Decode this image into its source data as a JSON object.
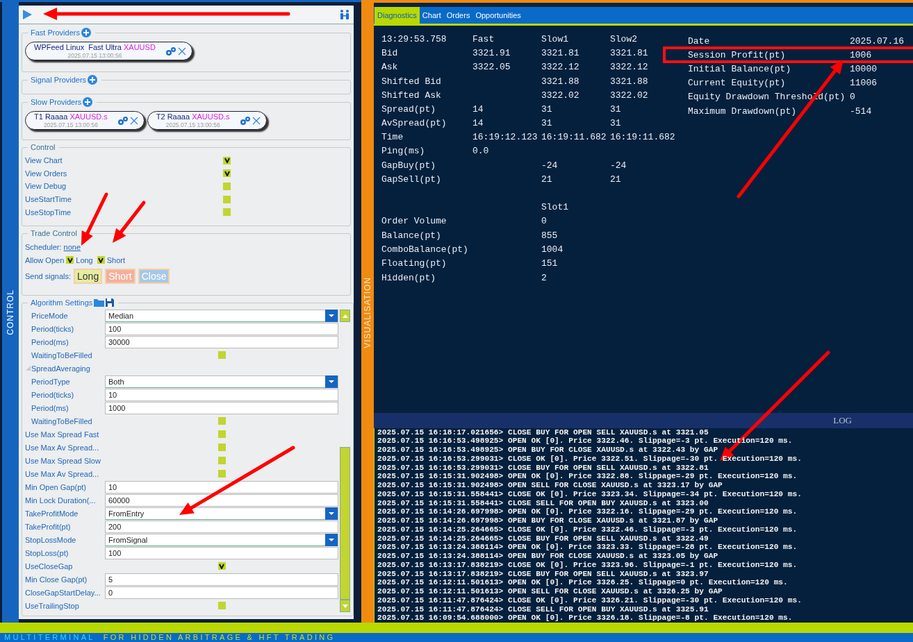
{
  "control_panel": {
    "side_label": "CONTROL",
    "fast_providers": {
      "title": "Fast Providers",
      "providers": [
        {
          "name": "WPFeed Linux  Fast Ultra",
          "symbol": "XAUUSD",
          "timestamp": "2025.07.15 13:00:56"
        }
      ]
    },
    "signal_providers": {
      "title": "Signal Providers"
    },
    "slow_providers": {
      "title": "Slow Providers",
      "providers": [
        {
          "name": "T1 Raaaa",
          "symbol": "XAUUSD.s",
          "timestamp": "2025.07.15 13:00:56"
        },
        {
          "name": "T2 Raaaa",
          "symbol": "XAUUSD.s",
          "timestamp": "2025.07.15 13:00:56"
        }
      ]
    },
    "control": {
      "title": "Control",
      "items": [
        {
          "label": "View Chart",
          "checked": true
        },
        {
          "label": "View Orders",
          "checked": true
        },
        {
          "label": "View Debug",
          "checked": false
        },
        {
          "label": "UseStartTime",
          "checked": false
        },
        {
          "label": "UseStopTime",
          "checked": false
        }
      ]
    },
    "trade_control": {
      "title": "Trade Control",
      "scheduler_label": "Scheduler:",
      "scheduler_value": "none",
      "allow_open_label": "Allow Open",
      "allow_open": [
        {
          "label": "Long",
          "checked": true
        },
        {
          "label": "Short",
          "checked": true
        }
      ],
      "send_signals_label": "Send signals:",
      "signal_buttons": [
        {
          "label": "Long",
          "kind": "long"
        },
        {
          "label": "Short",
          "kind": "short"
        },
        {
          "label": "Close",
          "kind": "close"
        }
      ]
    },
    "algorithm_settings": {
      "title": "Algorithm Settings",
      "rows": [
        {
          "kind": "group",
          "children": [
            {
              "kind": "dropdown",
              "label": "PriceMode",
              "value": "Median"
            },
            {
              "kind": "input",
              "label": "Period(ticks)",
              "value": "100"
            },
            {
              "kind": "input",
              "label": "Period(ms)",
              "value": "30000"
            },
            {
              "kind": "checkbox",
              "label": "WaitingToBeFilled",
              "checked": false
            }
          ]
        },
        {
          "kind": "group",
          "label": "SpreadAveraging",
          "expanded": true,
          "children": [
            {
              "kind": "dropdown",
              "label": "PeriodType",
              "value": "Both"
            },
            {
              "kind": "input",
              "label": "Period(ticks)",
              "value": "10"
            },
            {
              "kind": "input",
              "label": "Period(ms)",
              "value": "1000"
            },
            {
              "kind": "checkbox",
              "label": "WaitingToBeFilled",
              "checked": false
            }
          ]
        },
        {
          "kind": "checkbox",
          "label": "Use Max Spread Fast",
          "checked": false
        },
        {
          "kind": "checkbox",
          "label": "Use Max Av Spread...",
          "checked": false
        },
        {
          "kind": "checkbox",
          "label": "Use Max Spread Slow",
          "checked": false
        },
        {
          "kind": "checkbox",
          "label": "Use Max Av Spread...",
          "checked": false
        },
        {
          "kind": "input",
          "label": "Min Open Gap(pt)",
          "value": "10"
        },
        {
          "kind": "input",
          "label": "Min Lock Duration(...",
          "value": "60000"
        },
        {
          "kind": "dropdown",
          "label": "TakeProfitMode",
          "value": "FromEntry"
        },
        {
          "kind": "input",
          "label": "TakeProfit(pt)",
          "value": "200"
        },
        {
          "kind": "dropdown",
          "label": "StopLossMode",
          "value": "FromSignal"
        },
        {
          "kind": "input",
          "label": "StopLoss(pt)",
          "value": "100"
        },
        {
          "kind": "checkbox",
          "label": "UseCloseGap",
          "checked": true
        },
        {
          "kind": "input",
          "label": "Min Close Gap(pt)",
          "value": "5"
        },
        {
          "kind": "input",
          "label": "CloseGapStartDelay...",
          "value": "0"
        },
        {
          "kind": "checkbox",
          "label": "UseTrailingStop",
          "checked": false
        }
      ]
    }
  },
  "visualisation": {
    "side_label": "VISUALISATION",
    "tabs": [
      {
        "label": "Diagnostics",
        "selected": true
      },
      {
        "label": "Chart",
        "selected": false
      },
      {
        "label": "Orders",
        "selected": false
      },
      {
        "label": "Opportunities",
        "selected": false
      }
    ],
    "quotes": {
      "header": [
        "13:29:53.758",
        "Fast",
        "Slow1",
        "Slow2"
      ],
      "rows": [
        [
          "Bid",
          "3321.91",
          "3321.81",
          "3321.81"
        ],
        [
          "Ask",
          "3322.05",
          "3322.12",
          "3322.12"
        ],
        [
          "Shifted Bid",
          "",
          "3321.88",
          "3321.88"
        ],
        [
          "Shifted Ask",
          "",
          "3322.02",
          "3322.02"
        ],
        [
          "Spread(pt)",
          "14",
          "31",
          "31"
        ],
        [
          "AvSpread(pt)",
          "14",
          "31",
          "31"
        ],
        [
          "Time",
          "16:19:12.123",
          "16:19:11.682",
          "16:19:11.682"
        ],
        [
          "Ping(ms)",
          "0.0",
          "",
          ""
        ],
        [
          "GapBuy(pt)",
          "",
          "-24",
          "-24"
        ],
        [
          "GapSell(pt)",
          "",
          "21",
          "21"
        ]
      ]
    },
    "account": [
      {
        "label": "Date",
        "value": "2025.07.16",
        "highlighted": false
      },
      {
        "label": "Session Profit(pt)",
        "value": "1006",
        "highlighted": true
      },
      {
        "label": "Initial Balance(pt)",
        "value": "10000",
        "highlighted": false
      },
      {
        "label": "Current Equity(pt)",
        "value": "11006",
        "highlighted": false
      },
      {
        "label": "Equity Drawdown Threshold(pt)",
        "value": "0",
        "highlighted": false
      },
      {
        "label": "Maximum Drawdown(pt)",
        "value": "-514",
        "highlighted": false
      }
    ],
    "slots": {
      "header": "Slot1",
      "rows": [
        [
          "Order Volume",
          "0"
        ],
        [
          "Balance(pt)",
          "855"
        ],
        [
          "ComboBalance(pt)",
          "1004"
        ],
        [
          "Floating(pt)",
          "151"
        ],
        [
          "Hidden(pt)",
          "2"
        ]
      ]
    },
    "log": {
      "title": "LOG",
      "lines": [
        "2025.07.15 16:18:17.021656> CLOSE BUY FOR OPEN SELL XAUUSD.s at 3321.05",
        "2025.07.15 16:16:53.498925> OPEN OK [0]. Price 3322.46. Slippage=-3 pt. Execution=120 ms.",
        "2025.07.15 16:16:53.498925> OPEN BUY FOR CLOSE XAUUSD.s at 3322.43 by GAP",
        "2025.07.15 16:16:53.299031> CLOSE OK [0]. Price 3322.51. Slippage=-30 pt. Execution=120 ms.",
        "2025.07.15 16:16:53.299031> CLOSE BUY FOR OPEN SELL XAUUSD.s at 3322.81",
        "2025.07.15 16:15:31.902498> OPEN OK [0]. Price 3322.88. Slippage=-29 pt. Execution=120 ms.",
        "2025.07.15 16:15:31.902498> OPEN SELL FOR CLOSE XAUUSD.s at 3323.17 by GAP",
        "2025.07.15 16:15:31.558441> CLOSE OK [0]. Price 3323.34. Slippage=-34 pt. Execution=120 ms.",
        "2025.07.15 16:15:31.558441> CLOSE SELL FOR OPEN BUY XAUUSD.s at 3323.00",
        "2025.07.15 16:14:26.697998> OPEN OK [0]. Price 3322.16. Slippage=-29 pt. Execution=120 ms.",
        "2025.07.15 16:14:26.697998> OPEN BUY FOR CLOSE XAUUSD.s at 3321.87 by GAP",
        "2025.07.15 16:14:25.264665> CLOSE OK [0]. Price 3322.46. Slippage=-3 pt. Execution=120 ms.",
        "2025.07.15 16:14:25.264665> CLOSE BUY FOR OPEN SELL XAUUSD.s at 3322.49",
        "2025.07.15 16:13:24.388114> OPEN OK [0]. Price 3323.33. Slippage=-28 pt. Execution=120 ms.",
        "2025.07.15 16:13:24.388114> OPEN BUY FOR CLOSE XAUUSD.s at 3323.05 by GAP",
        "2025.07.15 16:13:17.838219> CLOSE OK [0]. Price 3323.96. Slippage=-1 pt. Execution=120 ms.",
        "2025.07.15 16:13:17.838219> CLOSE BUY FOR OPEN SELL XAUUSD.s at 3323.97",
        "2025.07.15 16:12:11.501613> OPEN OK [0]. Price 3326.25. Slippage=0 pt. Execution=120 ms.",
        "2025.07.15 16:12:11.501613> OPEN SELL FOR CLOSE XAUUSD.s at 3326.25 by GAP",
        "2025.07.15 16:11:47.876424> CLOSE OK [0]. Price 3326.21. Slippage=-30 pt. Execution=120 ms.",
        "2025.07.15 16:11:47.876424> CLOSE SELL FOR OPEN BUY XAUUSD.s at 3325.91",
        "2025.07.15 16:09:54.688000> OPEN OK [0]. Price 3326.18. Slippage=-8 pt. Execution=120 ms."
      ]
    }
  },
  "footer": {
    "brand": "MULTITERMINAL",
    "tagline": "FOR HIDDEN ARBITRAGE & HFT TRADING"
  }
}
